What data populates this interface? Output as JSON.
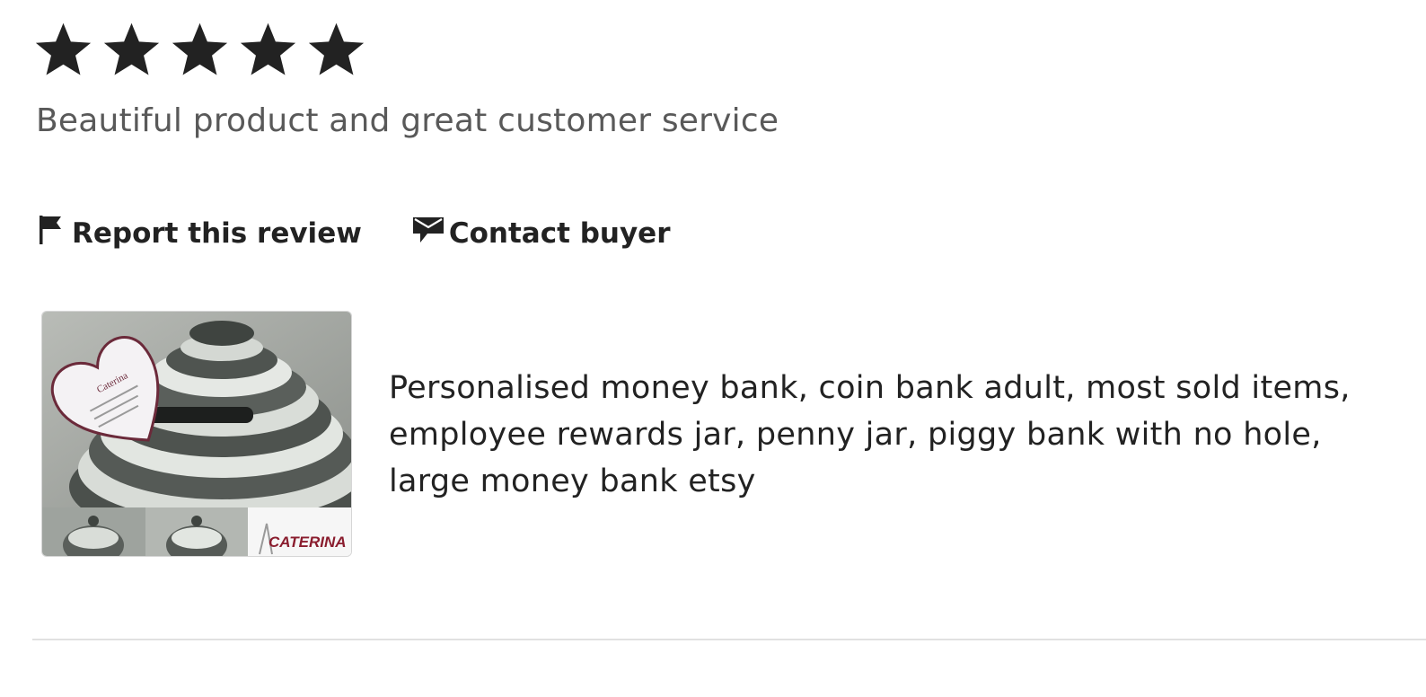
{
  "review": {
    "rating": 5,
    "rating_max": 5,
    "text": "Beautiful product and great customer service"
  },
  "actions": {
    "report_label": "Report this review",
    "contact_label": "Contact buyer",
    "report_icon": "flag-icon",
    "contact_icon": "message-icon"
  },
  "listing": {
    "title": "Personalised money bank, coin bank adult, most sold items, employee rewards jar, penny jar, piggy bank with no hole, large money bank etsy",
    "thumbnail_brand": "CATERINA"
  },
  "colors": {
    "star": "#222222",
    "review_text": "#595959",
    "body_text": "#222222",
    "divider": "#e1e1e1"
  }
}
